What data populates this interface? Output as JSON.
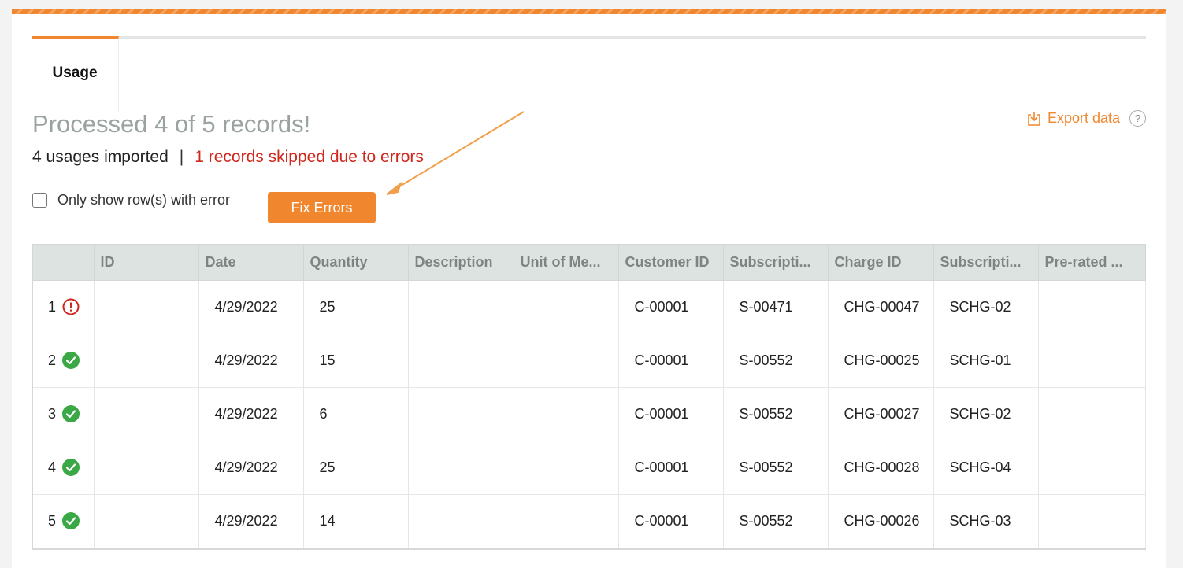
{
  "tabs": [
    {
      "label": "Usage",
      "active": true
    }
  ],
  "heading": "Processed 4 of 5 records!",
  "summary": {
    "imported": "4 usages imported",
    "separator": "|",
    "skipped": "1 records skipped due to errors"
  },
  "export": {
    "label": "Export data",
    "help": "?"
  },
  "filter": {
    "label": "Only show row(s) with error",
    "checked": false
  },
  "fix_button": {
    "label": "Fix Errors"
  },
  "table": {
    "columns": [
      "",
      "ID",
      "Date",
      "Quantity",
      "Description",
      "Unit of Me...",
      "Customer ID",
      "Subscripti...",
      "Charge ID",
      "Subscripti...",
      "Pre-rated ..."
    ],
    "rows": [
      {
        "num": "1",
        "status": "error",
        "id": "",
        "date": "4/29/2022",
        "quantity": "25",
        "description": "",
        "uom": "",
        "customer_id": "C-00001",
        "subscription": "S-00471",
        "charge_id": "CHG-00047",
        "sub_charge": "SCHG-02",
        "prerated": ""
      },
      {
        "num": "2",
        "status": "success",
        "id": "",
        "date": "4/29/2022",
        "quantity": "15",
        "description": "",
        "uom": "",
        "customer_id": "C-00001",
        "subscription": "S-00552",
        "charge_id": "CHG-00025",
        "sub_charge": "SCHG-01",
        "prerated": ""
      },
      {
        "num": "3",
        "status": "success",
        "id": "",
        "date": "4/29/2022",
        "quantity": "6",
        "description": "",
        "uom": "",
        "customer_id": "C-00001",
        "subscription": "S-00552",
        "charge_id": "CHG-00027",
        "sub_charge": "SCHG-02",
        "prerated": ""
      },
      {
        "num": "4",
        "status": "success",
        "id": "",
        "date": "4/29/2022",
        "quantity": "25",
        "description": "",
        "uom": "",
        "customer_id": "C-00001",
        "subscription": "S-00552",
        "charge_id": "CHG-00028",
        "sub_charge": "SCHG-04",
        "prerated": ""
      },
      {
        "num": "5",
        "status": "success",
        "id": "",
        "date": "4/29/2022",
        "quantity": "14",
        "description": "",
        "uom": "",
        "customer_id": "C-00001",
        "subscription": "S-00552",
        "charge_id": "CHG-00026",
        "sub_charge": "SCHG-03",
        "prerated": ""
      }
    ]
  },
  "colors": {
    "accent": "#f0872e",
    "error": "#d0271d",
    "success": "#3aa845",
    "header_bg": "#dde3e0"
  }
}
